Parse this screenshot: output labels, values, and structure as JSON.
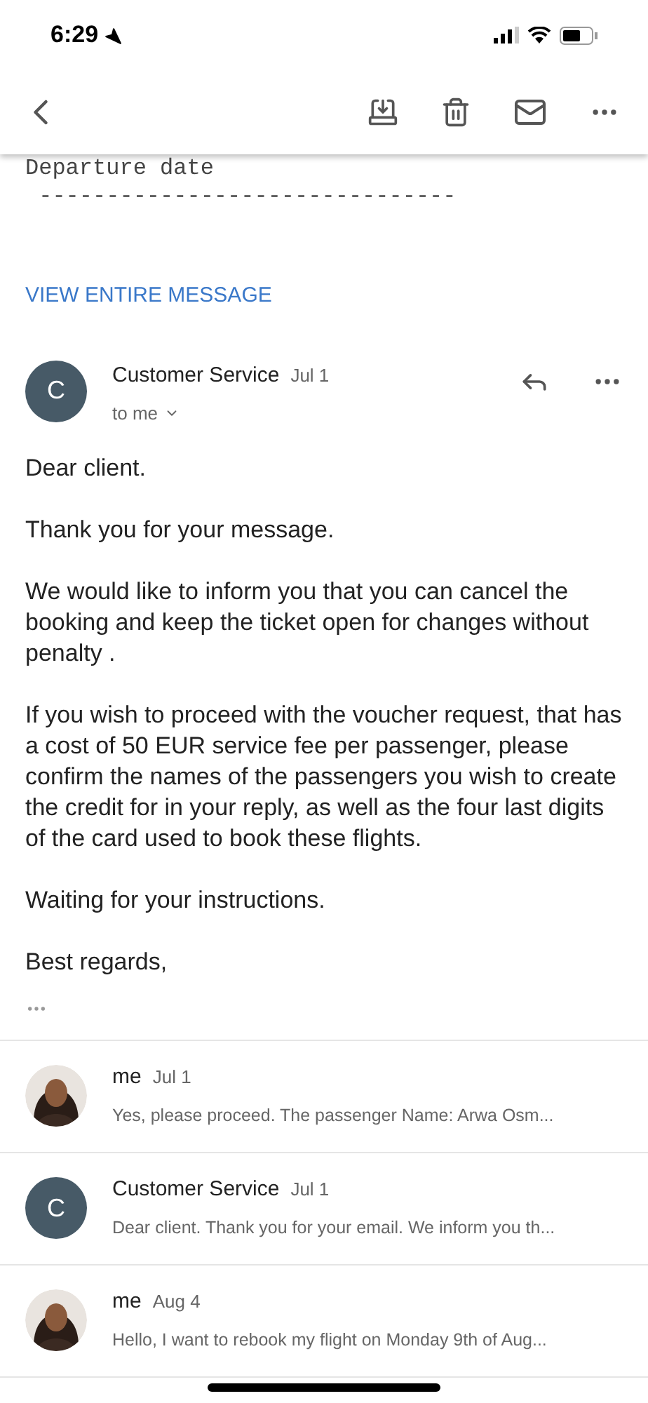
{
  "status_bar": {
    "time": "6:29"
  },
  "quoted_text": {
    "lines": [
      "Departure date",
      " -------------------------------"
    ]
  },
  "view_entire_message": "VIEW ENTIRE MESSAGE",
  "message": {
    "avatar": {
      "kind": "initial",
      "initial": "C"
    },
    "sender": "Customer Service",
    "date": "Jul 1",
    "recipient": "to me",
    "paragraphs": [
      "Dear client.",
      "Thank you for your message.",
      "We would like to inform you that you can cancel the booking and keep the ticket open for changes without penalty .",
      "If you wish to proceed with the voucher request, that has a cost of 50 EUR service fee per passenger, please confirm the names of the passengers you wish to create the credit for in your reply, as well as the four last digits of the card used to book these flights.",
      "Waiting for your instructions.",
      "Best regards,"
    ]
  },
  "thread": [
    {
      "sender": "me",
      "date": "Jul 1",
      "snippet": "Yes, please proceed. The passenger Name: Arwa Osm..."
    },
    {
      "avatar": {
        "kind": "initial",
        "initial": "C"
      },
      "sender": "Customer Service",
      "date": "Jul 1",
      "snippet": "Dear client. Thank you for your email. We inform you th..."
    },
    {
      "sender": "me",
      "date": "Aug 4",
      "snippet": "Hello, I want to rebook my flight on Monday 9th of Aug..."
    }
  ]
}
